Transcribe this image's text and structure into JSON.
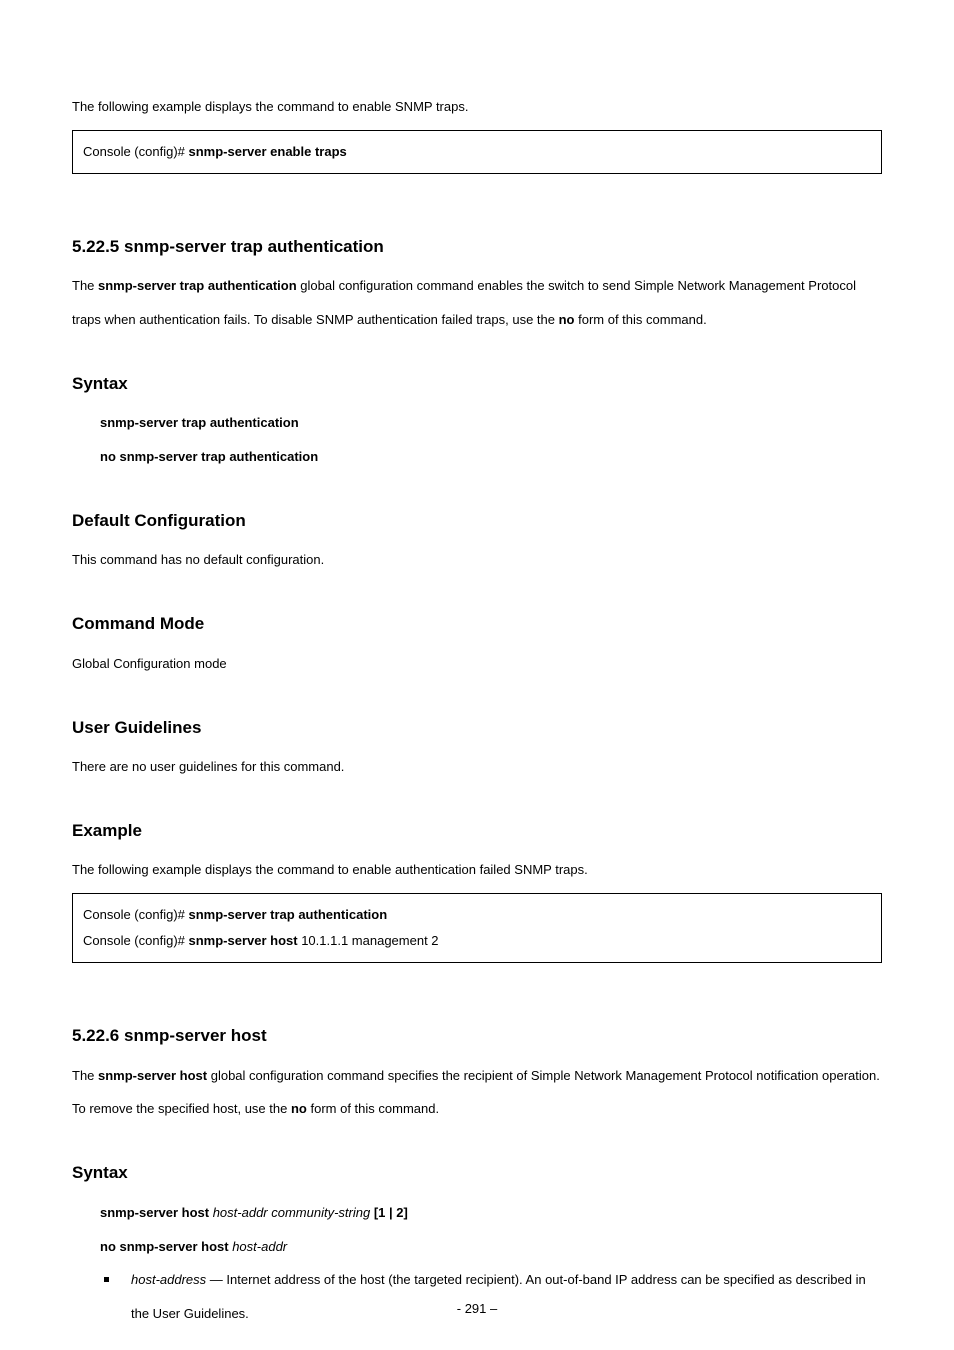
{
  "intro_example": "The following example displays the command to enable SNMP traps.",
  "codebox1": {
    "line1_prefix": "Console (config)# ",
    "line1_cmd": "snmp-server enable traps"
  },
  "cmd1": {
    "heading": "5.22.5      snmp-server trap authentication",
    "desc_1": "The ",
    "desc_bold": "snmp-server trap authentication",
    "desc_2": " global configuration command enables the switch to send Simple Network Management Protocol traps when authentication fails. To disable SNMP authentication failed traps, use the ",
    "desc_no": "no",
    "desc_3": " form of this command.",
    "syntax_heading": "Syntax",
    "syntax_l1": "snmp-server trap authentication",
    "syntax_l2": "no snmp-server trap authentication",
    "default_heading": "Default Configuration",
    "default_text": "This command has no default configuration.",
    "mode_heading": "Command Mode",
    "mode_text": "Global Configuration mode",
    "ug_heading": "User Guidelines",
    "ug_text": "There are no user guidelines for this command.",
    "ex_heading": "Example",
    "ex_text": "The following example displays the command to enable authentication failed SNMP traps."
  },
  "codebox2": {
    "line1_prefix": "Console (config)# ",
    "line1_cmd": "snmp-server trap authentication",
    "line2_prefix": "Console (config)# ",
    "line2_cmd": "snmp-server host",
    "line2_rest": " 10.1.1.1 management 2"
  },
  "cmd2": {
    "heading": "5.22.6      snmp-server host",
    "desc_1": "The ",
    "desc_bold": "snmp-server host",
    "desc_2": " global configuration command specifies the recipient of Simple Network Management Protocol notification operation. To remove the specified host, use the ",
    "desc_no": "no",
    "desc_3": " form of this command.",
    "syntax_heading": "Syntax",
    "syntax_l1_a": "snmp-server host ",
    "syntax_l1_b": "host-addr community-string ",
    "syntax_l1_c": "[1 | 2]",
    "syntax_l2_a": "no snmp-server host ",
    "syntax_l2_b": "host-addr",
    "bullet_italic": "host-address",
    "bullet_rest": " — Internet address of the host (the targeted recipient). An out-of-band IP address can be specified as described in the User Guidelines."
  },
  "footer": "- 291 –"
}
